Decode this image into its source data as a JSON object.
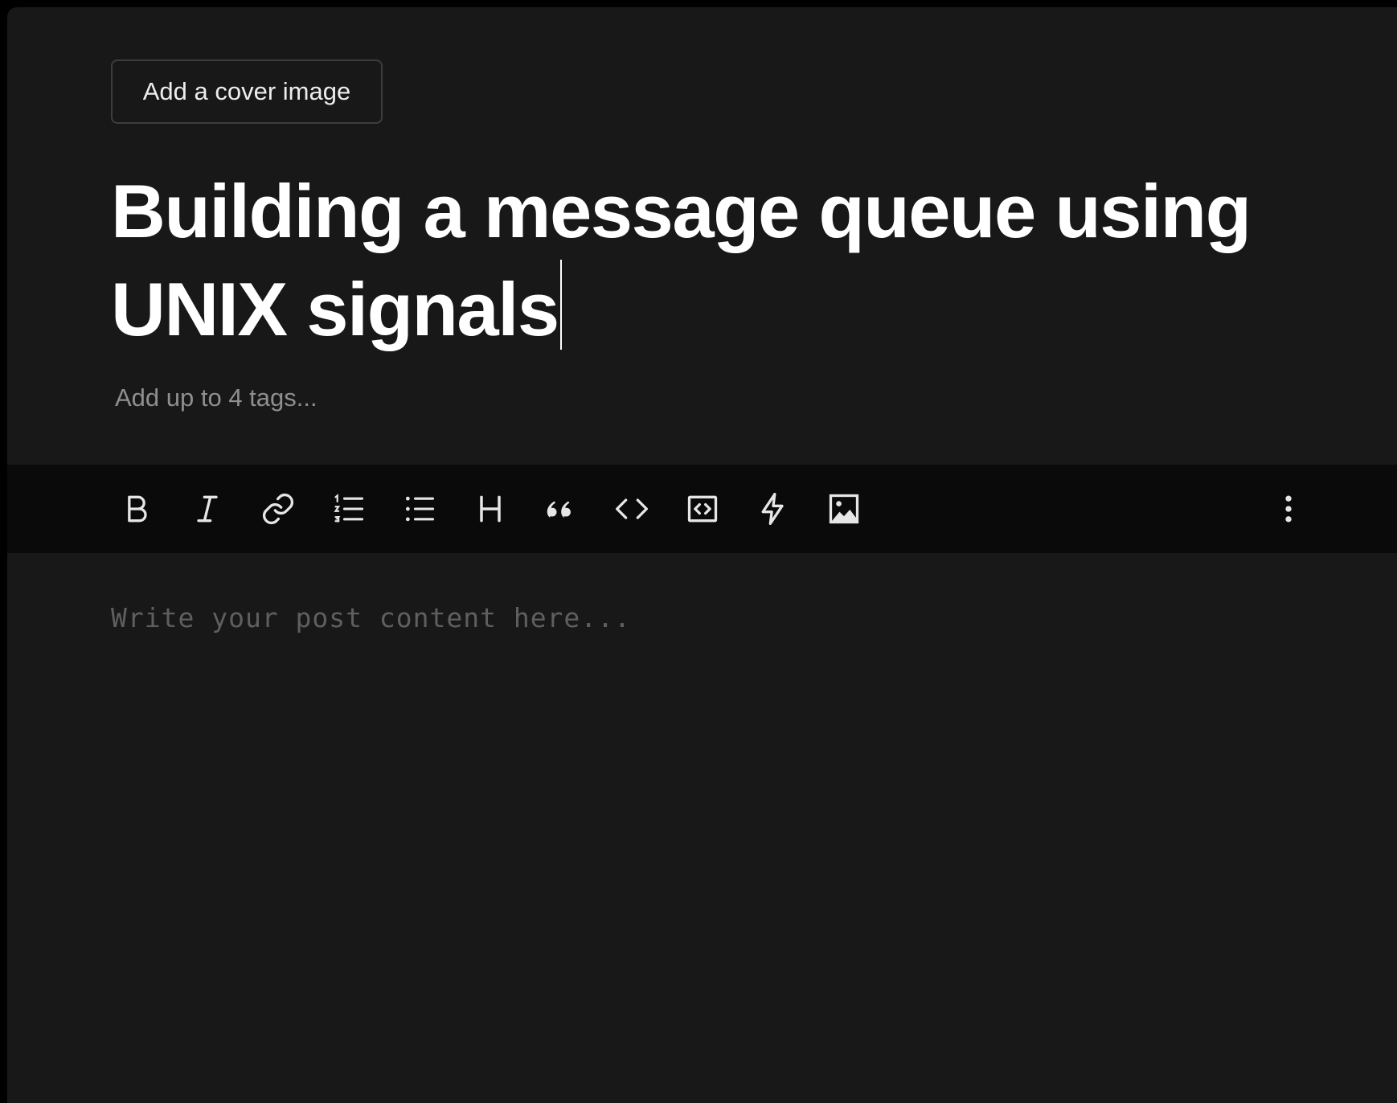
{
  "editor": {
    "cover_button_label": "Add a cover image",
    "title_text": "Building a message queue using UNIX signals",
    "tags_placeholder": "Add up to 4 tags...",
    "body_placeholder": "Write your post content here..."
  },
  "toolbar": {
    "items": [
      {
        "name": "bold",
        "icon": "bold-icon"
      },
      {
        "name": "italic",
        "icon": "italic-icon"
      },
      {
        "name": "link",
        "icon": "link-icon"
      },
      {
        "name": "ordered-list",
        "icon": "ordered-list-icon"
      },
      {
        "name": "unordered-list",
        "icon": "unordered-list-icon"
      },
      {
        "name": "heading",
        "icon": "heading-icon"
      },
      {
        "name": "quote",
        "icon": "quote-icon"
      },
      {
        "name": "code",
        "icon": "code-icon"
      },
      {
        "name": "code-block",
        "icon": "code-block-icon"
      },
      {
        "name": "embed",
        "icon": "lightning-icon"
      },
      {
        "name": "image",
        "icon": "image-icon"
      },
      {
        "name": "more",
        "icon": "more-vertical-icon"
      }
    ]
  },
  "colors": {
    "background": "#181818",
    "toolbar_background": "#0a0a0a",
    "title_text": "#ffffff",
    "placeholder_text": "#8f8f8f",
    "body_placeholder_text": "#5f5f5f"
  }
}
